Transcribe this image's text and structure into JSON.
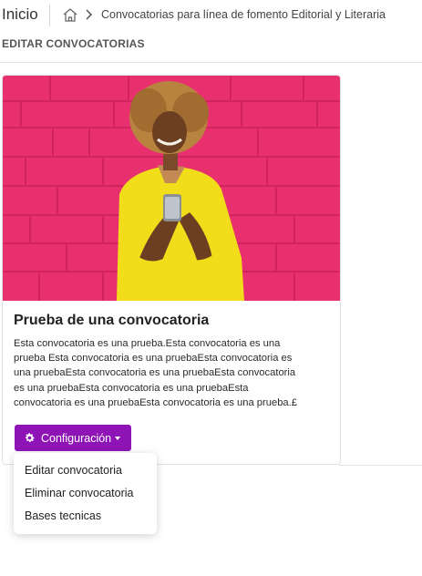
{
  "header": {
    "home_label": "Inicio",
    "breadcrumb": "Convocatorias para línea de fomento Editorial y Literaria"
  },
  "section_title": "EDITAR CONVOCATORIAS",
  "card": {
    "title": "Prueba de una convocatoria",
    "description_lines": [
      "Esta convocatoria es una prueba.Esta convocatoria es una",
      "prueba Esta convocatoria es una pruebaEsta convocatoria es",
      "una pruebaEsta convocatoria es una pruebaEsta convocatoria",
      "es una pruebaEsta convocatoria es una pruebaEsta",
      "convocatoria es una pruebaEsta convocatoria es una prueba.£"
    ],
    "config_button": "Configuración"
  },
  "dropdown": {
    "items": [
      "Editar convocatoria",
      "Eliminar convocatoria",
      "Bases tecnicas"
    ]
  },
  "colors": {
    "accent": "#8e14b5",
    "photo_wall": "#e8306e",
    "photo_shirt": "#f2dd1a"
  }
}
